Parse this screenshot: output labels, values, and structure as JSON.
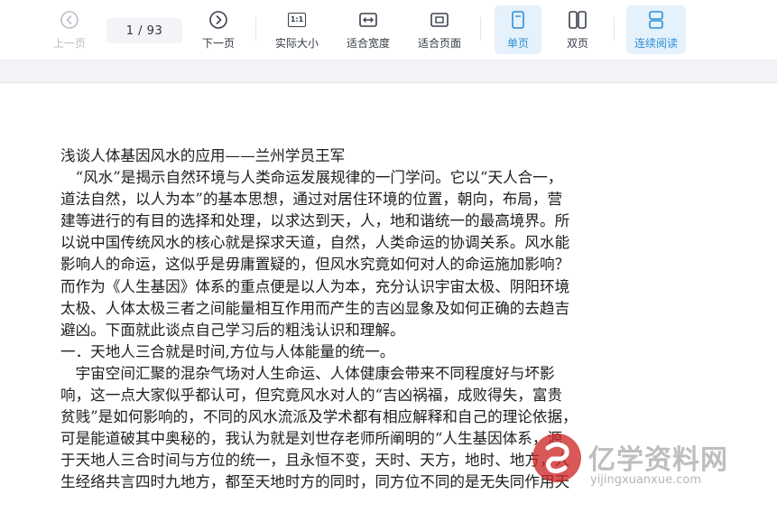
{
  "toolbar": {
    "prev_label": "上一页",
    "page_indicator": "1 / 93",
    "next_label": "下一页",
    "actual_size_label": "实际大小",
    "fit_width_label": "适合宽度",
    "fit_page_label": "适合页面",
    "single_page_label": "单页",
    "double_page_label": "双页",
    "continuous_label": "连续阅读",
    "actual_size_glyph": "1:1"
  },
  "colors": {
    "accent": "#2d8fd6",
    "active_bg": "#e5f1fb",
    "disabled": "#b9bec6"
  },
  "document": {
    "lines": [
      "浅谈人体基因风水的应用——兰州学员王军",
      "　“风水”是揭示自然环境与人类命运发展规律的一门学问。它以“天人合一，",
      "道法自然，以人为本”的基本思想，通过对居住环境的位置，朝向，布局，营",
      "建等进行的有目的选择和处理，以求达到天，人，地和谐统一的最高境界。所",
      "以说中国传统风水的核心就是探求天道，自然，人类命运的协调关系。风水能",
      "影响人的命运，这似乎是毋庸置疑的，但风水究竟如何对人的命运施加影响？",
      "而作为《人生基因》体系的重点便是以人为本，充分认识宇宙太极、阴阳环境",
      "太极、人体太极三者之间能量相互作用而产生的吉凶显象及如何正确的去趋吉",
      "避凶。下面就此谈点自己学习后的粗浅认识和理解。",
      "一．天地人三合就是时间,方位与人体能量的统一。",
      "　宇宙空间汇聚的混杂气场对人生命运、人体健康会带来不同程度好与坏影",
      "响，这一点大家似乎都认可，但究竟风水对人的“吉凶祸福，成败得失，富贵",
      "贫贱”是如何影响的，不同的风水流派及学术都有相应解释和自己的理论依据，",
      "可是能道破其中奥秘的，我认为就是刘世存老师所阐明的“人生基因体系，源",
      "于天地人三合时间与方位的统一，且永恒不变，天时、天方，地时、地方，人",
      "生经络共言四时九地方，都至天地时方的同时，同方位不同的是无失同作用天"
    ]
  },
  "watermark": {
    "brand": "亿学资料网",
    "url": "yijingxuanxue.com"
  }
}
